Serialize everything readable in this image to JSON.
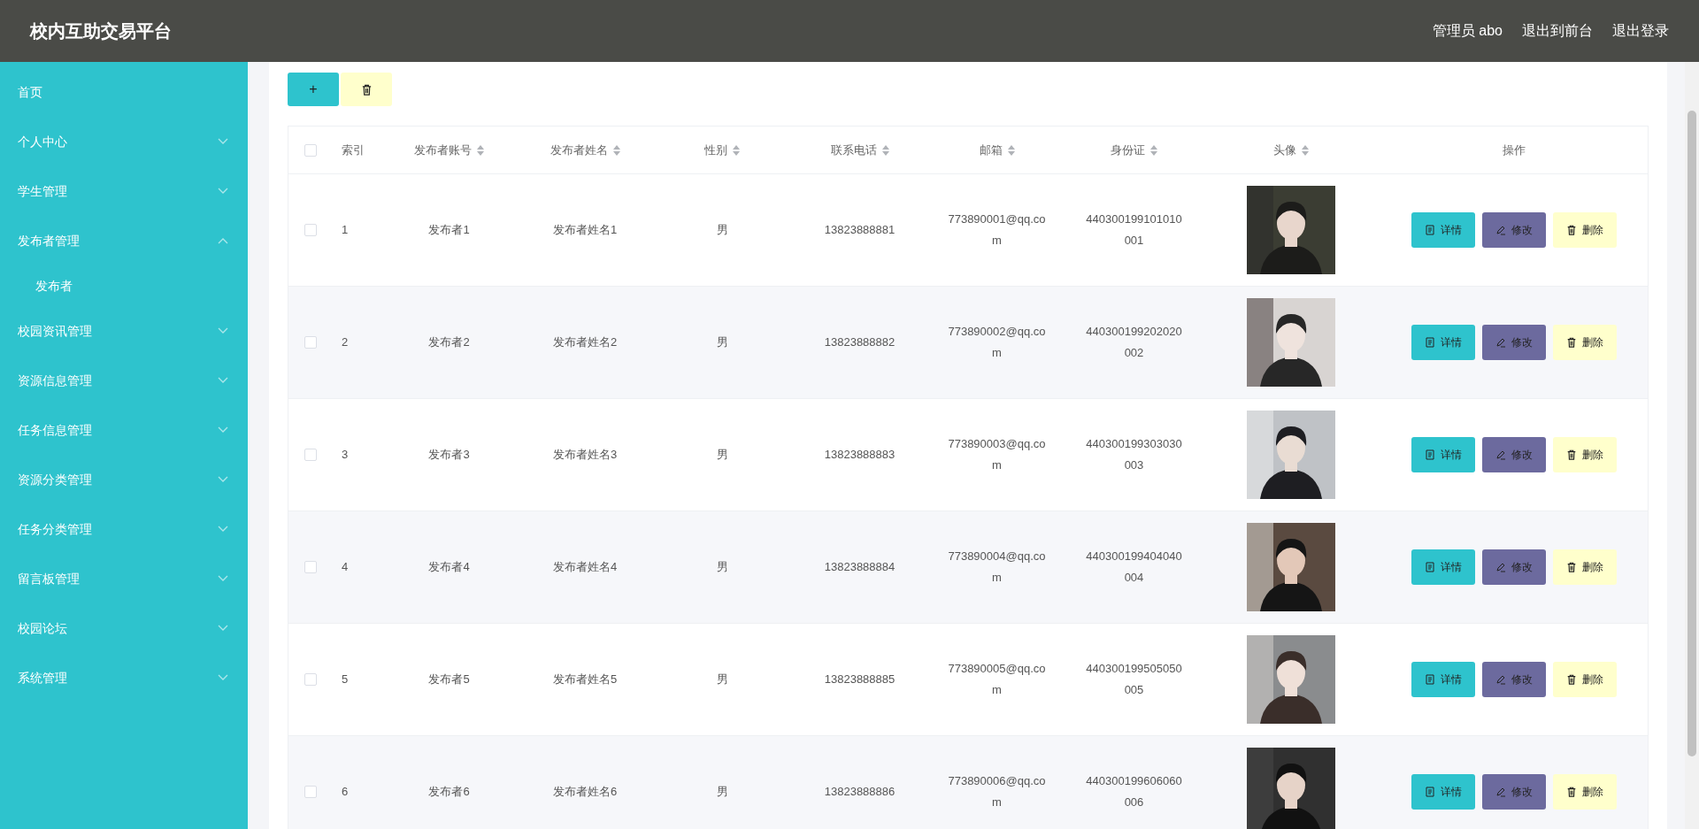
{
  "header": {
    "title": "校内互助交易平台",
    "links": [
      "管理员 abo",
      "退出到前台",
      "退出登录"
    ]
  },
  "sidebar": {
    "items": [
      {
        "label": "首页"
      },
      {
        "label": "个人中心",
        "expanded": false
      },
      {
        "label": "学生管理",
        "expanded": false
      },
      {
        "label": "发布者管理",
        "expanded": true,
        "children": [
          {
            "label": "发布者"
          }
        ]
      },
      {
        "label": "校园资讯管理",
        "expanded": false
      },
      {
        "label": "资源信息管理",
        "expanded": false
      },
      {
        "label": "任务信息管理",
        "expanded": false
      },
      {
        "label": "资源分类管理",
        "expanded": false
      },
      {
        "label": "任务分类管理",
        "expanded": false
      },
      {
        "label": "留言板管理",
        "expanded": false
      },
      {
        "label": "校园论坛",
        "expanded": false
      },
      {
        "label": "系统管理",
        "expanded": false
      }
    ]
  },
  "toolbar": {
    "add_label": "+"
  },
  "table": {
    "select_all_checked": false,
    "columns": [
      {
        "label": "索引",
        "sortable": false
      },
      {
        "label": "发布者账号",
        "sortable": true
      },
      {
        "label": "发布者姓名",
        "sortable": true
      },
      {
        "label": "性别",
        "sortable": true
      },
      {
        "label": "联系电话",
        "sortable": true
      },
      {
        "label": "邮箱",
        "sortable": true
      },
      {
        "label": "身份证",
        "sortable": true
      },
      {
        "label": "头像",
        "sortable": true
      },
      {
        "label": "操作",
        "sortable": false
      }
    ],
    "rows": [
      {
        "checked": false,
        "index": "1",
        "account": "发布者1",
        "name": "发布者姓名1",
        "gender": "男",
        "phone": "13823888881",
        "email": "773890001@qq.com",
        "id_card": "440300199101010001",
        "actions": [
          "详情",
          "修改",
          "删除"
        ]
      },
      {
        "checked": false,
        "index": "2",
        "account": "发布者2",
        "name": "发布者姓名2",
        "gender": "男",
        "phone": "13823888882",
        "email": "773890002@qq.com",
        "id_card": "440300199202020002",
        "actions": [
          "详情",
          "修改",
          "删除"
        ]
      },
      {
        "checked": false,
        "index": "3",
        "account": "发布者3",
        "name": "发布者姓名3",
        "gender": "男",
        "phone": "13823888883",
        "email": "773890003@qq.com",
        "id_card": "440300199303030003",
        "actions": [
          "详情",
          "修改",
          "删除"
        ]
      },
      {
        "checked": false,
        "index": "4",
        "account": "发布者4",
        "name": "发布者姓名4",
        "gender": "男",
        "phone": "13823888884",
        "email": "773890004@qq.com",
        "id_card": "440300199404040004",
        "actions": [
          "详情",
          "修改",
          "删除"
        ]
      },
      {
        "checked": false,
        "index": "5",
        "account": "发布者5",
        "name": "发布者姓名5",
        "gender": "男",
        "phone": "13823888885",
        "email": "773890005@qq.com",
        "id_card": "440300199505050005",
        "actions": [
          "详情",
          "修改",
          "删除"
        ]
      },
      {
        "checked": false,
        "index": "6",
        "account": "发布者6",
        "name": "发布者姓名6",
        "gender": "男",
        "phone": "13823888886",
        "email": "773890006@qq.com",
        "id_card": "440300199606060006",
        "actions": [
          "详情",
          "修改",
          "删除"
        ]
      }
    ]
  }
}
